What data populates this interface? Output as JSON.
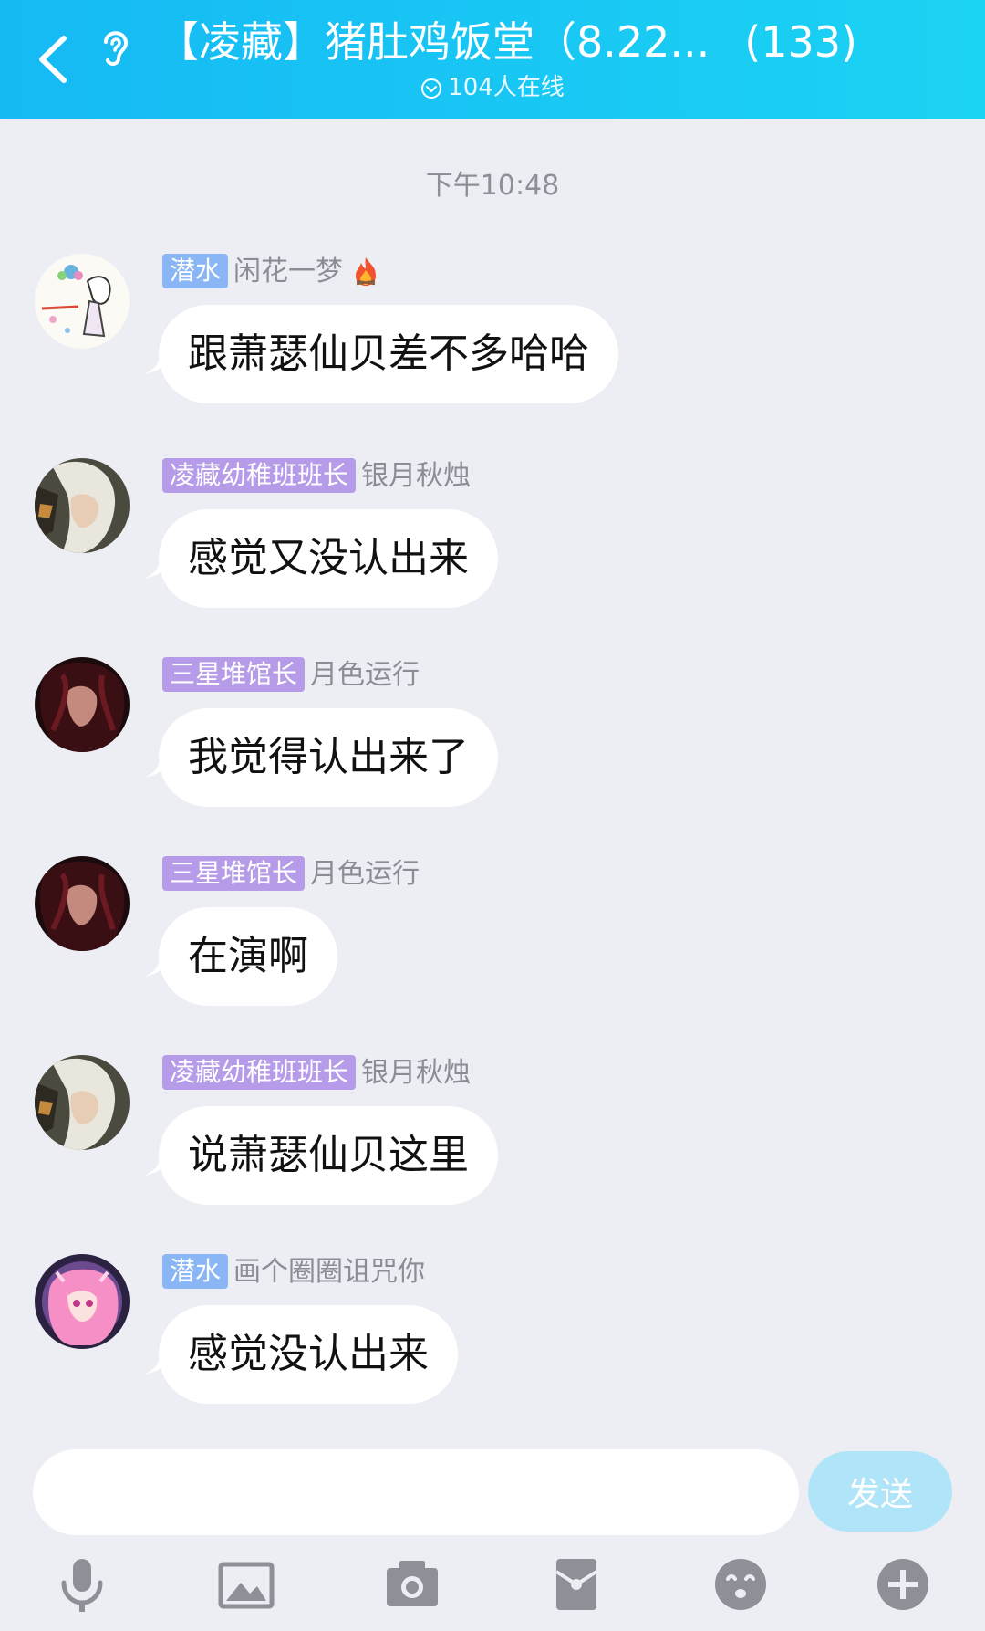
{
  "header": {
    "title": "【凌藏】猪肚鸡饭堂（8.22...",
    "member_count": "(133)",
    "online_text": "104人在线",
    "gradient_start": "#16b9f4",
    "gradient_end": "#1bd3f3"
  },
  "chat": {
    "timestamp": "下午10:48",
    "messages": [
      {
        "badge": "潜水",
        "badge_color": "#8ab6f5",
        "nickname": "闲花一梦",
        "text": "跟萧瑟仙贝差不多哈哈",
        "has_fire": true,
        "avatar": "avatar-sketch"
      },
      {
        "badge": "凌藏幼稚班班长",
        "badge_color": "#b69be8",
        "nickname": "银月秋烛",
        "text": "感觉又没认出来",
        "has_fire": false,
        "avatar": "avatar-silver-hair"
      },
      {
        "badge": "三星堆馆长",
        "badge_color": "#b69be8",
        "nickname": "月色运行",
        "text": "我觉得认出来了",
        "has_fire": false,
        "avatar": "avatar-dark-hair"
      },
      {
        "badge": "三星堆馆长",
        "badge_color": "#b69be8",
        "nickname": "月色运行",
        "text": "在演啊",
        "has_fire": false,
        "avatar": "avatar-dark-hair"
      },
      {
        "badge": "凌藏幼稚班班长",
        "badge_color": "#b69be8",
        "nickname": "银月秋烛",
        "text": "说萧瑟仙贝这里",
        "has_fire": false,
        "avatar": "avatar-silver-hair"
      },
      {
        "badge": "潜水",
        "badge_color": "#8ab6f5",
        "nickname": "画个圈圈诅咒你",
        "text": "感觉没认出来",
        "has_fire": false,
        "avatar": "avatar-pink-hair"
      }
    ]
  },
  "composer": {
    "placeholder": "",
    "send_label": "发送"
  },
  "toolbar": {
    "icons": [
      "microphone-icon",
      "image-icon",
      "camera-icon",
      "red-packet-icon",
      "emoji-icon",
      "plus-icon"
    ],
    "icon_color": "#8d9097"
  }
}
